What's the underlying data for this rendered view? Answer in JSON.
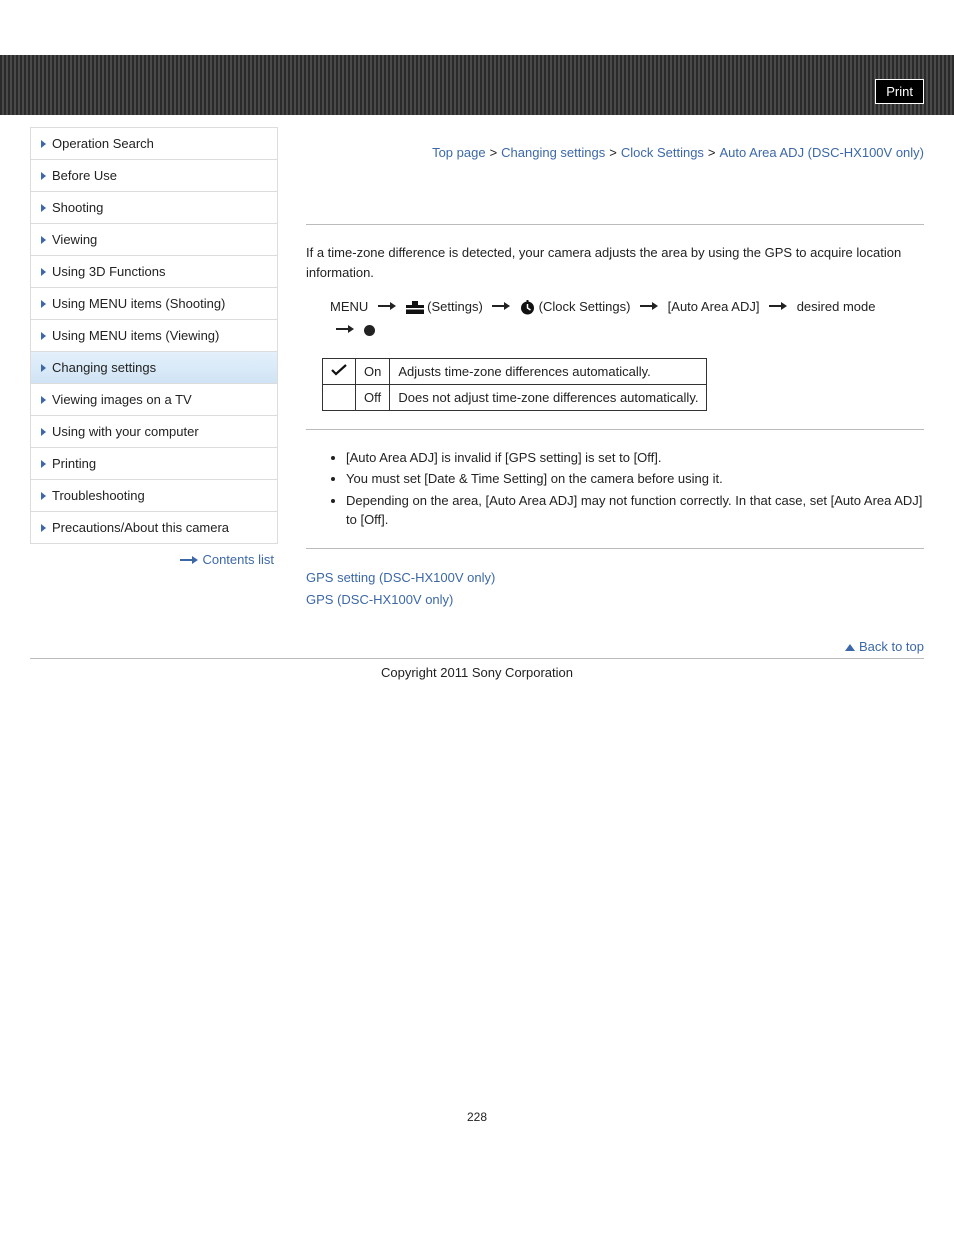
{
  "print_label": "Print",
  "breadcrumb": {
    "top": "Top page",
    "b1": "Changing settings",
    "b2": "Clock Settings",
    "current": "Auto Area ADJ (DSC-HX100V only)"
  },
  "sidebar": {
    "items": [
      {
        "label": "Operation Search"
      },
      {
        "label": "Before Use"
      },
      {
        "label": "Shooting"
      },
      {
        "label": "Viewing"
      },
      {
        "label": "Using 3D Functions"
      },
      {
        "label": "Using MENU items (Shooting)"
      },
      {
        "label": "Using MENU items (Viewing)"
      },
      {
        "label": "Changing settings"
      },
      {
        "label": "Viewing images on a TV"
      },
      {
        "label": "Using with your computer"
      },
      {
        "label": "Printing"
      },
      {
        "label": "Troubleshooting"
      },
      {
        "label": "Precautions/About this camera"
      }
    ],
    "active_index": 7,
    "contents_list": "Contents list"
  },
  "article": {
    "intro": "If a time-zone difference is detected, your camera adjusts the area by using the GPS to acquire location information.",
    "menupath": {
      "menu": "MENU",
      "settings": "(Settings)",
      "clock": "(Clock Settings)",
      "item": "[Auto Area ADJ]",
      "desired": "desired mode"
    },
    "table": {
      "r1": {
        "opt": "On",
        "desc": "Adjusts time-zone differences automatically."
      },
      "r2": {
        "opt": "Off",
        "desc": "Does not adjust time-zone differences automatically."
      }
    },
    "notes": [
      "[Auto Area ADJ] is invalid if [GPS setting] is set to [Off].",
      "You must set [Date & Time Setting] on the camera before using it.",
      "Depending on the area, [Auto Area ADJ] may not function correctly. In that case, set [Auto Area ADJ] to [Off]."
    ],
    "related": {
      "l1": "GPS setting (DSC-HX100V only)",
      "l2": "GPS (DSC-HX100V only)"
    }
  },
  "back_to_top": "Back to top",
  "copyright": "Copyright 2011 Sony Corporation",
  "page_number": "228"
}
